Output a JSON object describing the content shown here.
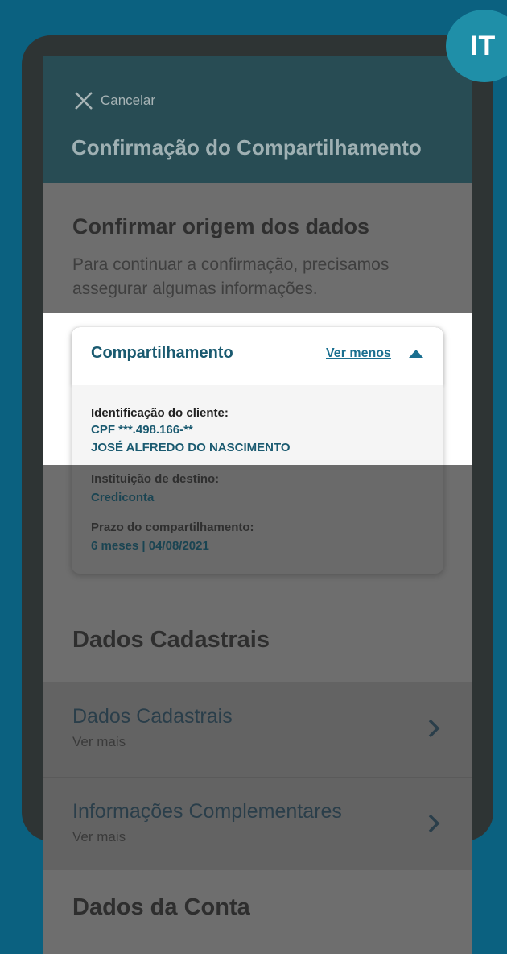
{
  "badge": {
    "label": "IT"
  },
  "header": {
    "cancel_label": "Cancelar",
    "title": "Confirmação do Compartilhamento"
  },
  "intro": {
    "title": "Confirmar origem dos dados",
    "description": "Para continuar a confirmação, precisamos assegurar algumas informações."
  },
  "card": {
    "title": "Compartilhamento",
    "toggle_label": "Ver menos",
    "fields": [
      {
        "label": "Identificação do cliente:",
        "values": [
          "CPF ***.498.166-**",
          "JOSÉ ALFREDO DO NASCIMENTO"
        ]
      },
      {
        "label": "Instituição de destino:",
        "values": [
          "Crediconta"
        ]
      },
      {
        "label": "Prazo do compartilhamento:",
        "values": [
          "6 meses | 04/08/2021"
        ]
      }
    ]
  },
  "section_cadastrais": {
    "title": "Dados Cadastrais",
    "items": [
      {
        "label": "Dados Cadastrais",
        "sub": "Ver mais"
      },
      {
        "label": "Informações Complementares",
        "sub": "Ver mais"
      }
    ]
  },
  "section_conta": {
    "title": "Dados da Conta"
  },
  "colors": {
    "background": "#0b6180",
    "header": "#284c54",
    "accent": "#1a6f90"
  }
}
